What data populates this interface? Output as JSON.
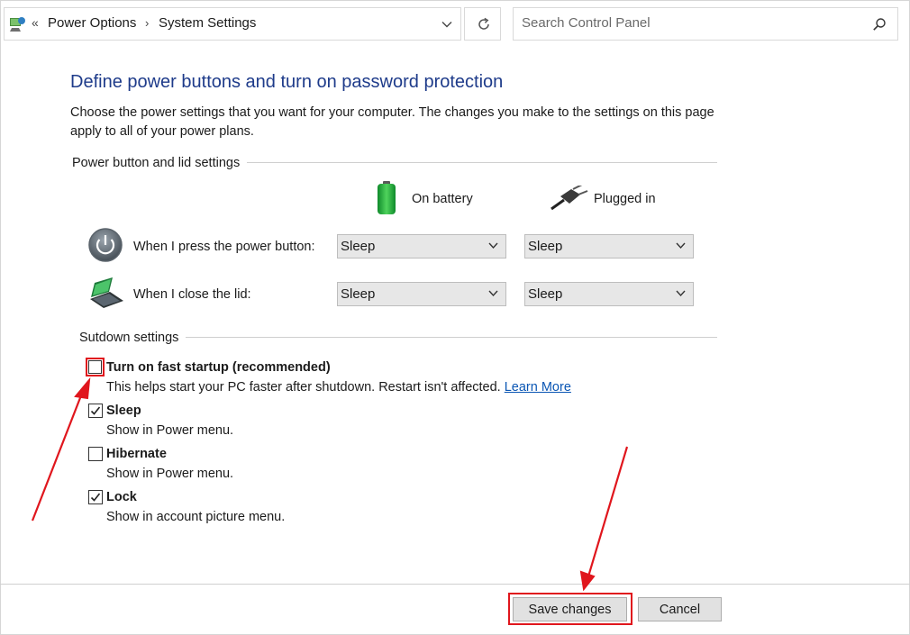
{
  "address_bar": {
    "overflow": "«",
    "crumbs": [
      "Power Options",
      "System Settings"
    ]
  },
  "search": {
    "placeholder": "Search Control Panel"
  },
  "heading": "Define power buttons and turn on password protection",
  "description": "Choose the power settings that you want for your computer. The changes you make to the settings on this page apply to all of your power plans.",
  "power_section": {
    "title": "Power button and lid settings",
    "columns": [
      "On battery",
      "Plugged in"
    ],
    "rows": [
      {
        "label": "When I press the power button:",
        "battery": "Sleep",
        "plugged": "Sleep"
      },
      {
        "label": "When I close the lid:",
        "battery": "Sleep",
        "plugged": "Sleep"
      }
    ]
  },
  "shutdown_section": {
    "title": "Sutdown settings",
    "options": [
      {
        "title": "Turn on fast startup (recommended)",
        "desc": "This helps start your PC faster after shutdown. Restart isn't affected.",
        "link": "Learn More",
        "checked": false
      },
      {
        "title": "Sleep",
        "desc": "Show in Power menu.",
        "checked": true
      },
      {
        "title": "Hibernate",
        "desc": "Show in Power menu.",
        "checked": false
      },
      {
        "title": "Lock",
        "desc": "Show in account picture menu.",
        "checked": true
      }
    ]
  },
  "buttons": {
    "save": "Save changes",
    "cancel": "Cancel"
  },
  "colors": {
    "heading": "#1e3b8a",
    "link": "#0a56b4",
    "highlight": "#e0161d"
  }
}
